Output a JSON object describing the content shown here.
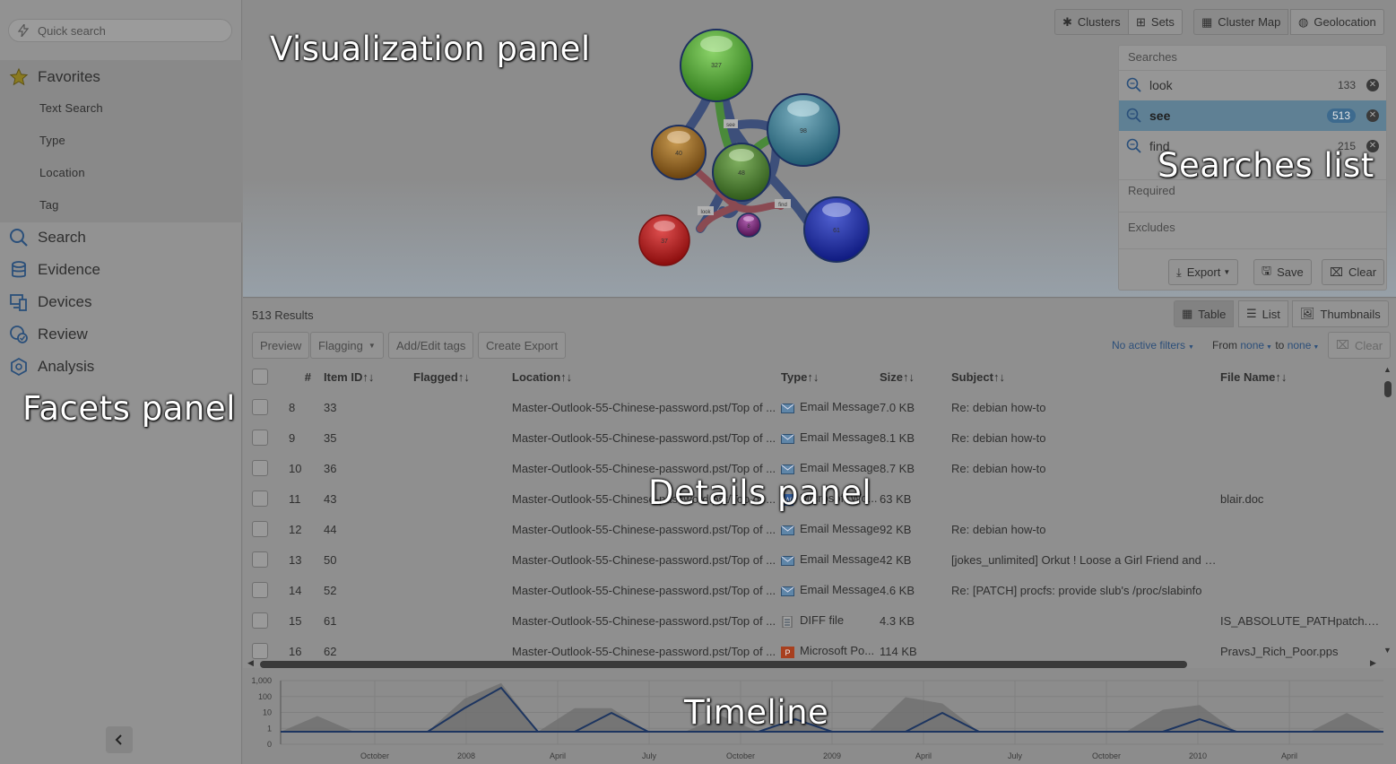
{
  "facets": {
    "quick_search_placeholder": "Quick search",
    "favorites_label": "Favorites",
    "favorites_items": [
      "Text Search",
      "Type",
      "Location",
      "Tag"
    ],
    "nav": [
      {
        "label": "Search",
        "icon": "search-icon"
      },
      {
        "label": "Evidence",
        "icon": "database-icon"
      },
      {
        "label": "Devices",
        "icon": "devices-icon"
      },
      {
        "label": "Review",
        "icon": "review-icon"
      },
      {
        "label": "Analysis",
        "icon": "analysis-icon"
      }
    ],
    "overlay_label": "Facets panel"
  },
  "visualization": {
    "overlay_label": "Visualization panel",
    "view_buttons": [
      "Clusters",
      "Sets",
      "Cluster Map",
      "Geolocation"
    ],
    "clusters": [
      {
        "count": "327",
        "color": "#3f9a2a"
      },
      {
        "count": "98",
        "color": "#2f6f86"
      },
      {
        "count": "40",
        "color": "#8a5a1a"
      },
      {
        "count": "48",
        "color": "#3f7a2a"
      },
      {
        "count": "37",
        "color": "#b81818"
      },
      {
        "count": "8",
        "color": "#7a1f7a"
      },
      {
        "count": "61",
        "color": "#1a2fa0"
      }
    ],
    "edge_labels": [
      "see",
      "look",
      "find"
    ]
  },
  "searches": {
    "header": "Searches",
    "items": [
      {
        "term": "look",
        "count": "133",
        "selected": false
      },
      {
        "term": "see",
        "count": "513",
        "selected": true
      },
      {
        "term": "find",
        "count": "215",
        "selected": false
      }
    ],
    "required_label": "Required",
    "excludes_label": "Excludes",
    "export_label": "Export",
    "save_label": "Save",
    "clear_label": "Clear",
    "overlay_label": "Searches list"
  },
  "details": {
    "overlay_label": "Details panel",
    "results_count": "513 Results",
    "view_modes": [
      "Table",
      "List",
      "Thumbnails"
    ],
    "toolbar": {
      "preview": "Preview",
      "flagging": "Flagging",
      "add_edit_tags": "Add/Edit tags",
      "create_export": "Create Export",
      "no_active_filters": "No active filters",
      "from": "From",
      "to": "to",
      "none_from": "none",
      "none_to": "none",
      "clear": "Clear"
    },
    "columns": [
      "#",
      "Item ID",
      "Flagged",
      "Location",
      "Type",
      "Size",
      "Subject",
      "File Name"
    ],
    "rows": [
      {
        "n": "8",
        "id": "33",
        "location": "Master-Outlook-55-Chinese-password.pst/Top of ...",
        "type_icon": "email-icon",
        "type": "Email Message",
        "size": "7.0 KB",
        "subject": "Re: debian how-to",
        "file": ""
      },
      {
        "n": "9",
        "id": "35",
        "location": "Master-Outlook-55-Chinese-password.pst/Top of ...",
        "type_icon": "email-icon",
        "type": "Email Message",
        "size": "8.1 KB",
        "subject": "Re: debian how-to",
        "file": ""
      },
      {
        "n": "10",
        "id": "36",
        "location": "Master-Outlook-55-Chinese-password.pst/Top of ...",
        "type_icon": "email-icon",
        "type": "Email Message",
        "size": "8.7 KB",
        "subject": "Re: debian how-to",
        "file": ""
      },
      {
        "n": "11",
        "id": "43",
        "location": "Master-Outlook-55-Chinese-password.pst/Top of ...",
        "type_icon": "word-icon",
        "type": "Microsoft Wo...",
        "size": "63 KB",
        "subject": "",
        "file": "blair.doc"
      },
      {
        "n": "12",
        "id": "44",
        "location": "Master-Outlook-55-Chinese-password.pst/Top of ...",
        "type_icon": "email-icon",
        "type": "Email Message",
        "size": "92 KB",
        "subject": "Re: debian how-to",
        "file": ""
      },
      {
        "n": "13",
        "id": "50",
        "location": "Master-Outlook-55-Chinese-password.pst/Top of ...",
        "type_icon": "email-icon",
        "type": "Email Message",
        "size": "42 KB",
        "subject": "[jokes_unlimited] Orkut ! Loose a Girl Friend and e...",
        "file": ""
      },
      {
        "n": "14",
        "id": "52",
        "location": "Master-Outlook-55-Chinese-password.pst/Top of ...",
        "type_icon": "email-icon",
        "type": "Email Message",
        "size": "4.6 KB",
        "subject": "Re: [PATCH] procfs: provide slub's /proc/slabinfo",
        "file": ""
      },
      {
        "n": "15",
        "id": "61",
        "location": "Master-Outlook-55-Chinese-password.pst/Top of ...",
        "type_icon": "diff-icon",
        "type": "DIFF file",
        "size": "4.3 KB",
        "subject": "",
        "file": "IS_ABSOLUTE_PATHpatch.diff"
      },
      {
        "n": "16",
        "id": "62",
        "location": "Master-Outlook-55-Chinese-password.pst/Top of ...",
        "type_icon": "powerpoint-icon",
        "type": "Microsoft Po...",
        "size": "114 KB",
        "subject": "",
        "file": "PravsJ_Rich_Poor.pps"
      }
    ]
  },
  "timeline": {
    "overlay_label": "Timeline",
    "y_ticks": [
      "1,000",
      "100",
      "10",
      "1",
      "0"
    ],
    "x_ticks": [
      "October",
      "2008",
      "April",
      "July",
      "October",
      "2009",
      "April",
      "July",
      "October",
      "2010",
      "April"
    ],
    "chart_data": {
      "type": "area",
      "scale": "log",
      "series": [
        {
          "peaks_log_value": [
            0,
            1.0,
            0,
            0,
            0,
            2.1,
            3.1,
            0,
            1.5,
            1.5,
            0,
            0,
            1.0,
            0,
            0.9,
            0,
            0,
            2.2,
            1.8,
            0,
            0,
            0,
            0,
            0,
            1.4,
            1.7,
            0,
            0,
            0,
            1.2,
            0
          ]
        },
        {
          "line_log_value": [
            0,
            0,
            0,
            0,
            0,
            1.5,
            2.8,
            0,
            0,
            1.2,
            0,
            0,
            0,
            0,
            0.8,
            0,
            0,
            0,
            1.2,
            0,
            0,
            0,
            0,
            0,
            0,
            0.8,
            0,
            0,
            0,
            0,
            0
          ]
        }
      ]
    }
  }
}
